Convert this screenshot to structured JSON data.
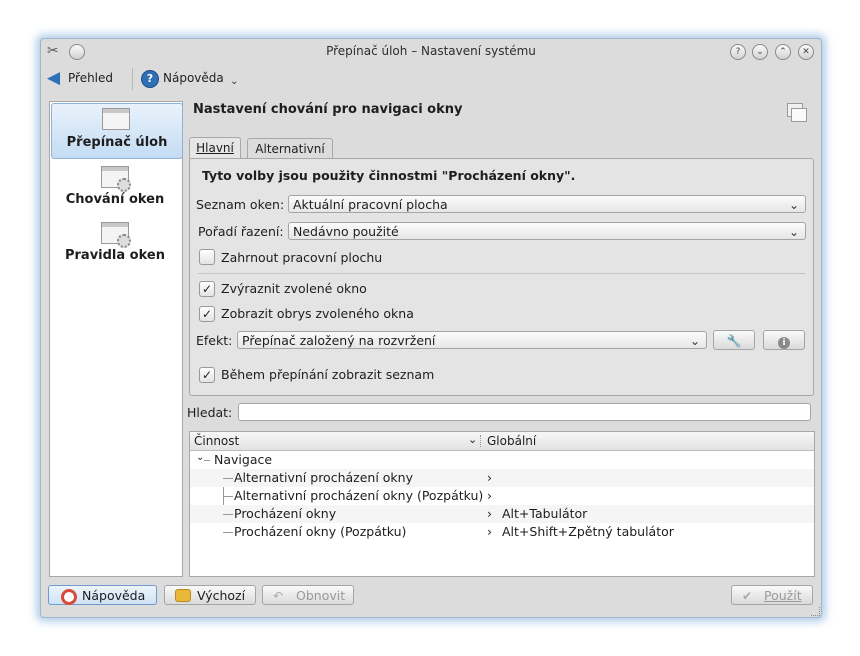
{
  "window": {
    "title": "Přepínač úloh – Nastavení systému",
    "title_buttons": [
      {
        "icon": "help-icon",
        "glyph": "?"
      },
      {
        "icon": "minimize-icon",
        "glyph": "⌄"
      },
      {
        "icon": "maximize-icon",
        "glyph": "⌃"
      },
      {
        "icon": "close-icon",
        "glyph": "✕"
      }
    ]
  },
  "toolbar": {
    "overview_label": "Přehled",
    "help_label": "Nápověda"
  },
  "sidebar": {
    "items": [
      {
        "label": "Přepínač úloh",
        "selected": true
      },
      {
        "label": "Chování oken",
        "selected": false
      },
      {
        "label": "Pravidla oken",
        "selected": false
      }
    ]
  },
  "main": {
    "heading": "Nastavení chování pro navigaci okny",
    "tabs": [
      {
        "label": "Hlavní",
        "active": true
      },
      {
        "label": "Alternativní",
        "active": false
      }
    ],
    "intro": "Tyto volby jsou použity činnostmi \"Procházení okny\".",
    "window_list_label": "Seznam oken:",
    "window_list_value": "Aktuální pracovní plocha",
    "sort_order_label": "Pořadí řazení:",
    "sort_order_value": "Nedávno použité",
    "include_desktop_label": "Zahrnout pracovní plochu",
    "include_desktop_checked": false,
    "highlight_label": "Zvýraznit zvolené okno",
    "highlight_checked": true,
    "outline_label": "Zobrazit obrys zvoleného okna",
    "outline_checked": true,
    "effect_label": "Efekt:",
    "effect_value": "Přepínač založený na rozvržení",
    "show_list_label": "Během přepínání zobrazit seznam",
    "show_list_checked": true
  },
  "search": {
    "label": "Hledat:",
    "value": ""
  },
  "shortcuts": {
    "columns": [
      "Činnost",
      "Globální"
    ],
    "group": "Navigace",
    "rows": [
      {
        "action": "Alternativní procházení okny",
        "shortcut": ""
      },
      {
        "action": "Alternativní procházení okny (Pozpátku)",
        "shortcut": ""
      },
      {
        "action": "Procházení okny",
        "shortcut": "Alt+Tabulátor"
      },
      {
        "action": "Procházení okny (Pozpátku)",
        "shortcut": "Alt+Shift+Zpětný tabulátor"
      }
    ]
  },
  "footer": {
    "help_label": "Nápověda",
    "defaults_label": "Výchozí",
    "reset_label": "Obnovit",
    "apply_label": "Použít"
  },
  "colors": {
    "accent": "#2f6fb5",
    "selection": "#c4dcf3"
  }
}
